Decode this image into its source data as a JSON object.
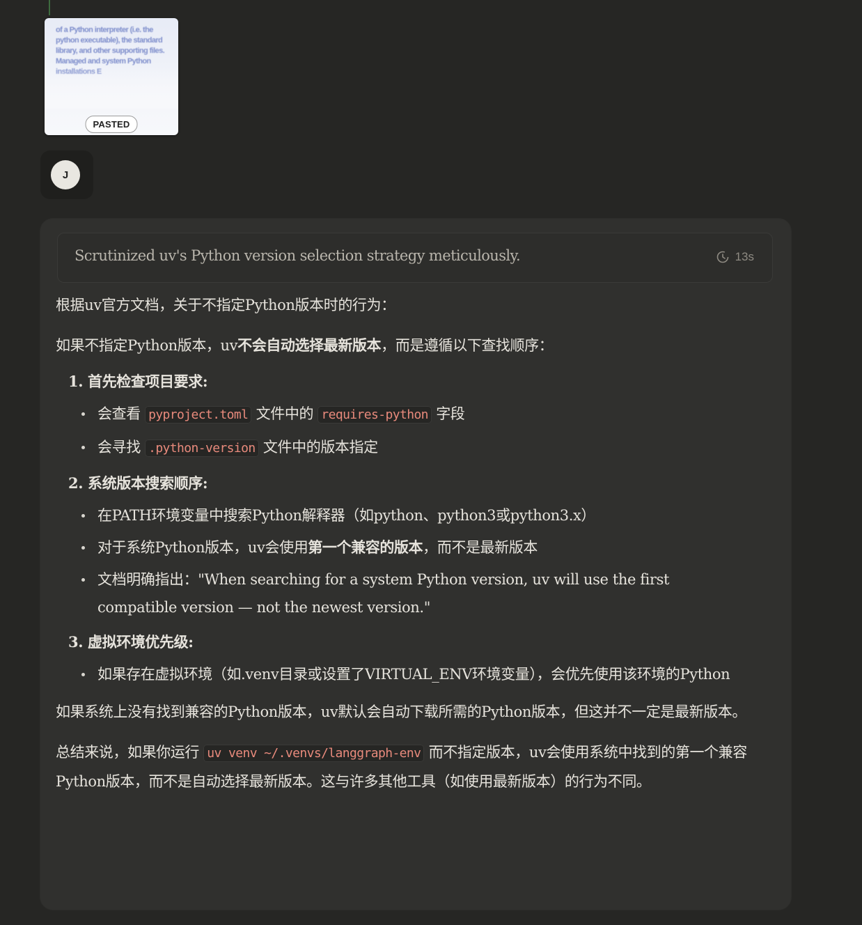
{
  "pasted": {
    "snippet": "of a Python interpreter (i.e. the python executable), the standard library, and other supporting files. Managed and system Python installations E",
    "badge": "PASTED"
  },
  "avatar": {
    "initial": "J"
  },
  "thinking": {
    "title": "Scrutinized uv's Python version selection strategy meticulously.",
    "duration": "13s"
  },
  "response": {
    "intro": "根据uv官方文档，关于不指定Python版本时的行为：",
    "lead_pre": "如果不指定Python版本，uv",
    "lead_bold": "不会自动选择最新版本",
    "lead_post": "，而是遵循以下查找顺序：",
    "sections": [
      {
        "title": "1. 首先检查项目要求",
        "title_suffix": ":",
        "items": [
          {
            "pre": "会查看 ",
            "code": "pyproject.toml",
            "mid": " 文件中的 ",
            "code2": "requires-python",
            "post": " 字段"
          },
          {
            "pre": "会寻找 ",
            "code": ".python-version",
            "post": " 文件中的版本指定"
          }
        ]
      },
      {
        "title": "2. 系统版本搜索顺序",
        "title_suffix": ":",
        "items": [
          {
            "text": "在PATH环境变量中搜索Python解释器（如python、python3或python3.x）"
          },
          {
            "pre": "对于系统Python版本，uv会使用",
            "bold": "第一个兼容的版本",
            "post": "，而不是最新版本"
          },
          {
            "text": "文档明确指出：\"When searching for a system Python version, uv will use the first compatible version — not the newest version.\""
          }
        ]
      },
      {
        "title": "3. 虚拟环境优先级",
        "title_suffix": ":",
        "items": [
          {
            "text": "如果存在虚拟环境（如.venv目录或设置了VIRTUAL_ENV环境变量），会优先使用该环境的Python"
          }
        ]
      }
    ],
    "fallback": "如果系统上没有找到兼容的Python版本，uv默认会自动下载所需的Python版本，但这并不一定是最新版本。",
    "summary_pre": "总结来说，如果你运行 ",
    "summary_code": "uv venv ~/.venvs/langgraph-env",
    "summary_post": " 而不指定版本，uv会使用系统中找到的第一个兼容Python版本，而不是自动选择最新版本。这与许多其他工具（如使用最新版本）的行为不同。"
  }
}
